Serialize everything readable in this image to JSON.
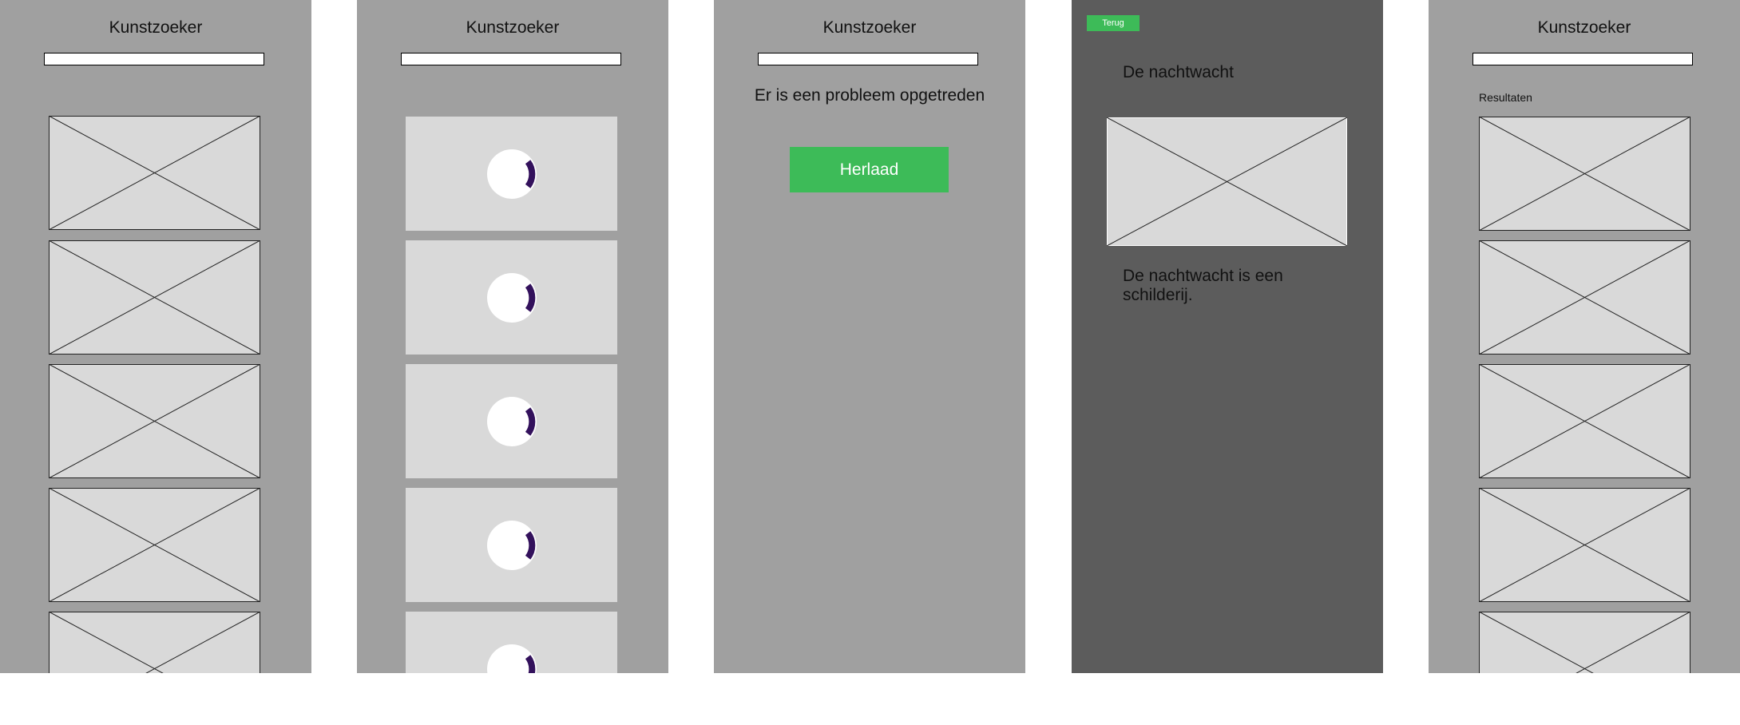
{
  "app": {
    "title": "Kunstzoeker"
  },
  "search": {
    "value": "",
    "placeholder": ""
  },
  "placeholder_image_icon": "image-placeholder-icon",
  "spinner": {
    "color": "#33115c",
    "icon": "loading-spinner-icon"
  },
  "error_screen": {
    "message": "Er is een probleem opgetreden",
    "reload_label": "Herlaad"
  },
  "detail_screen": {
    "back_label": "Terug",
    "title": "De nachtwacht",
    "description": "De nachtwacht is een schilderij."
  },
  "results_screen": {
    "label": "Resultaten"
  },
  "colors": {
    "screen_background": "#a0a0a0",
    "detail_background": "#5c5c5c",
    "card_background": "#d9d9d9",
    "button_green": "#3dbb58"
  }
}
